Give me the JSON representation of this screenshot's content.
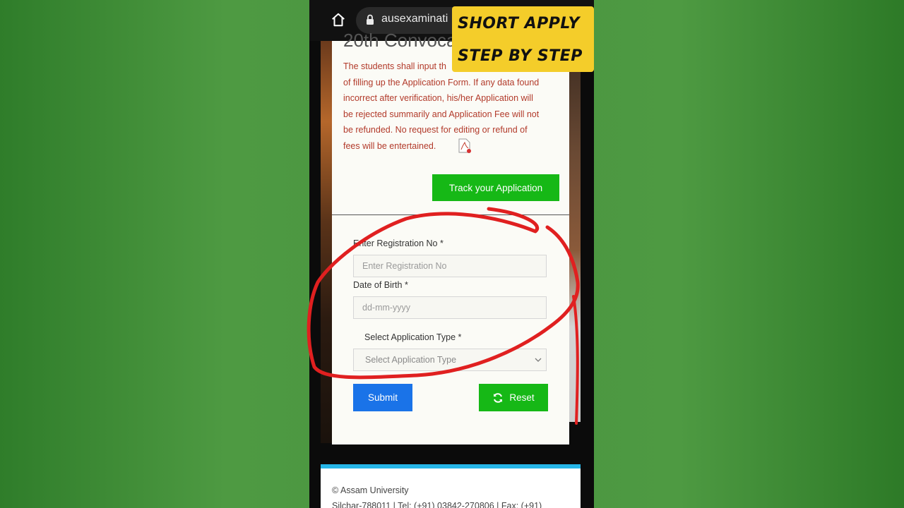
{
  "browser": {
    "url": "ausexaminati"
  },
  "overlay": {
    "line1": "SHORT APPLY",
    "line2": "STEP BY STEP"
  },
  "page": {
    "heading": "20th Convoca",
    "notice": "The students shall input th... of filling up the Application Form. If any data found incorrect after verification, his/her Application will be rejected summarily and Application Fee will not be refunded. No request for editing or refund of fees will be entertained.",
    "notice_lines": [
      "The students shall input th",
      "of filling up the Application Form. If any data found",
      "incorrect after verification, his/her Application will",
      "be rejected summarily and Application Fee will not",
      "be refunded. No request for editing or refund of",
      "fees will be entertained."
    ],
    "track_button": "Track your Application"
  },
  "form": {
    "reg_label": "Enter Registration No *",
    "reg_placeholder": "Enter Registration No",
    "dob_label": "Date of Birth *",
    "dob_placeholder": "dd-mm-yyyy",
    "type_label": "Select Application Type *",
    "type_selected": "Select Application Type",
    "submit": "Submit",
    "reset": "Reset"
  },
  "footer": {
    "line1": "© Assam University",
    "line2": "Silchar-788011 | Tel: (+91) 03842-270806 | Fax: (+91)"
  },
  "colors": {
    "accent_green": "#16b816",
    "submit_blue": "#1a73e8",
    "notice_red": "#b23a2a",
    "annotation_red": "#e02020",
    "badge_yellow": "#f4cd2a"
  }
}
